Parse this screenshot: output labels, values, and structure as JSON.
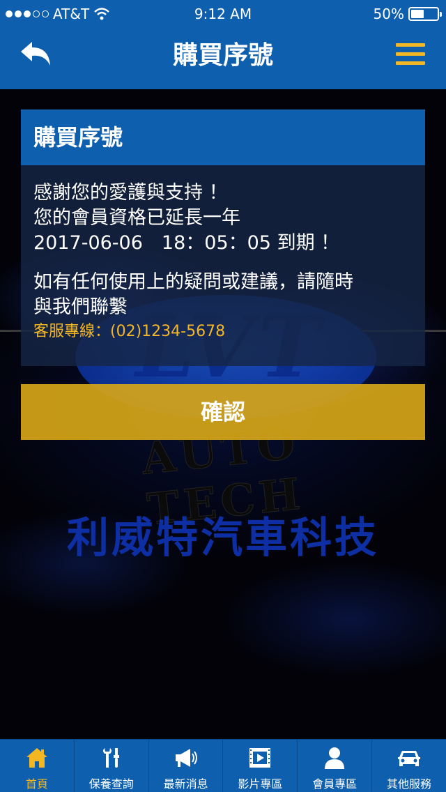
{
  "status_bar": {
    "carrier": "AT&T",
    "time": "9:12 AM",
    "battery": "50%"
  },
  "nav": {
    "title": "購買序號",
    "back_icon": "back-arrow-icon",
    "menu_icon": "hamburger-menu-icon"
  },
  "dialog": {
    "title": "購買序號",
    "line1": "感謝您的愛護與支持 ！",
    "line2": "您的會員資格已延長一年",
    "line3": "2017-06-06　18：05：05 到期 ！",
    "line4": "如有任何使用上的疑問或建議，請隨時",
    "line5": "與我們聯繫",
    "hotline": "客服專線：(02)1234-5678",
    "confirm_label": "確認"
  },
  "background": {
    "logo_text": "LVT",
    "logo_sub": "AUTO TECH",
    "company_name": "利威特汽車科技"
  },
  "tabs": [
    {
      "label": "首頁",
      "icon": "home-icon",
      "active": true
    },
    {
      "label": "保養查詢",
      "icon": "tools-icon",
      "active": false
    },
    {
      "label": "最新消息",
      "icon": "megaphone-icon",
      "active": false
    },
    {
      "label": "影片專區",
      "icon": "video-icon",
      "active": false
    },
    {
      "label": "會員專區",
      "icon": "user-icon",
      "active": false
    },
    {
      "label": "其他服務",
      "icon": "car-icon",
      "active": false
    }
  ],
  "colors": {
    "primary_blue": "#0e5fad",
    "accent_yellow": "#f4b724",
    "confirm_yellow": "#d6a618"
  }
}
